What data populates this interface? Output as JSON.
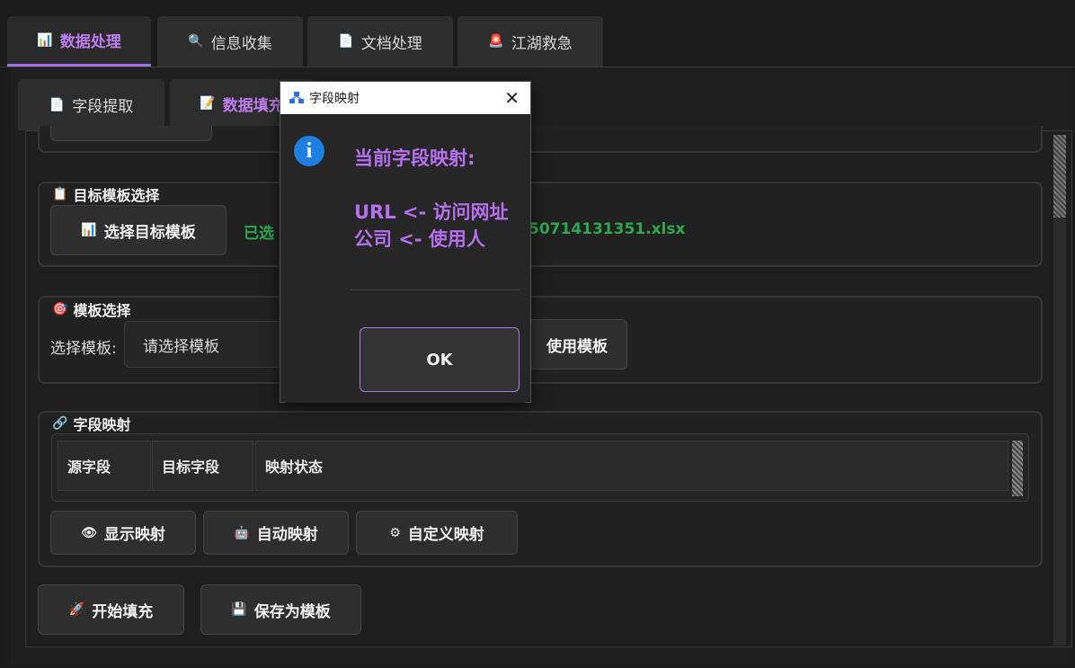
{
  "top_tabs": [
    {
      "icon": "📊",
      "label": "数据处理",
      "active": true
    },
    {
      "icon": "🔍",
      "label": "信息收集",
      "active": false
    },
    {
      "icon": "📄",
      "label": "文档处理",
      "active": false
    },
    {
      "icon": "🚨",
      "label": "江湖救急",
      "active": false
    }
  ],
  "sub_tabs": [
    {
      "icon": "📄",
      "label": "字段提取",
      "active": false
    },
    {
      "icon": "📝",
      "label": "数据填充",
      "active": true
    }
  ],
  "target_template": {
    "title_icon": "📋",
    "title": "目标模板选择",
    "select_button_icon": "📊",
    "select_button": "选择目标模板",
    "selected_prefix": "已选",
    "selected_suffix": "50714131351.xlsx"
  },
  "template_select": {
    "title_icon": "🎯",
    "title": "模板选择",
    "label": "选择模板:",
    "placeholder": "请选择模板",
    "use_button": "使用模板"
  },
  "field_mapping": {
    "title_icon": "🔗",
    "title": "字段映射",
    "columns": [
      "源字段",
      "目标字段",
      "映射状态"
    ],
    "buttons": [
      {
        "icon": "👁",
        "label": "显示映射"
      },
      {
        "icon": "🤖",
        "label": "自动映射"
      },
      {
        "icon": "⚙",
        "label": "自定义映射"
      }
    ]
  },
  "bottom_buttons": [
    {
      "icon": "🚀",
      "label": "开始填充"
    },
    {
      "icon": "💾",
      "label": "保存为模板"
    }
  ],
  "dialog": {
    "title": "字段映射",
    "message_title": "当前字段映射:",
    "lines": [
      "URL <- 访问网址",
      "公司 <- 使用人"
    ],
    "ok": "OK"
  },
  "colors": {
    "accent": "#a36ee8",
    "accent_text": "#c07cf0",
    "success": "#2ea84f",
    "info": "#1e7fe0"
  }
}
